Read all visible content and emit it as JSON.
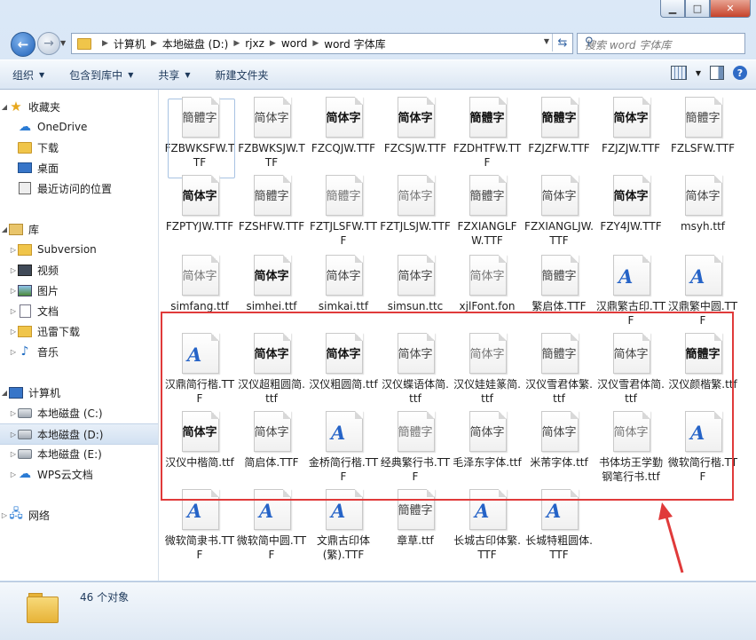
{
  "window": {
    "minimize": "▁",
    "maximize": "□",
    "close": "✕"
  },
  "breadcrumbs": [
    "计算机",
    "本地磁盘 (D:)",
    "rjxz",
    "word",
    "word 字体库"
  ],
  "search_placeholder": "搜索 word 字体库",
  "toolbar": {
    "organize": "组织",
    "include": "包含到库中",
    "share": "共享",
    "new_folder": "新建文件夹"
  },
  "sidebar": {
    "favorites": "收藏夹",
    "onedrive": "OneDrive",
    "downloads": "下载",
    "desktop": "桌面",
    "recent": "最近访问的位置",
    "libraries": "库",
    "subversion": "Subversion",
    "videos": "视频",
    "pictures": "图片",
    "documents": "文档",
    "xunlei": "迅雷下载",
    "music": "音乐",
    "computer": "计算机",
    "drive_c": "本地磁盘 (C:)",
    "drive_d": "本地磁盘 (D:)",
    "drive_e": "本地磁盘 (E:)",
    "wps": "WPS云文档",
    "network": "网络"
  },
  "files": [
    {
      "name": "FZBWKSFW.TTF",
      "glyph": "簡體字",
      "style": "mid"
    },
    {
      "name": "FZBWKSJW.TTF",
      "glyph": "简体字",
      "style": "mid"
    },
    {
      "name": "FZCQJW.TTF",
      "glyph": "简体字",
      "style": "bold"
    },
    {
      "name": "FZCSJW.TTF",
      "glyph": "简体字",
      "style": "bold"
    },
    {
      "name": "FZDHTFW.TTF",
      "glyph": "簡體字",
      "style": "bold"
    },
    {
      "name": "FZJZFW.TTF",
      "glyph": "簡體字",
      "style": "bold"
    },
    {
      "name": "FZJZJW.TTF",
      "glyph": "简体字",
      "style": "bold"
    },
    {
      "name": "FZLSFW.TTF",
      "glyph": "簡體字",
      "style": "mid"
    },
    {
      "name": "FZPTYJW.TTF",
      "glyph": "简体字",
      "style": "bold"
    },
    {
      "name": "FZSHFW.TTF",
      "glyph": "簡體字",
      "style": "mid"
    },
    {
      "name": "FZTJLSFW.TTF",
      "glyph": "簡體字",
      "style": "light"
    },
    {
      "name": "FZTJLSJW.TTF",
      "glyph": "简体字",
      "style": "light"
    },
    {
      "name": "FZXIANGLFW.TTF",
      "glyph": "簡體字",
      "style": "mid"
    },
    {
      "name": "FZXIANGLJW.TTF",
      "glyph": "简体字",
      "style": "mid"
    },
    {
      "name": "FZY4JW.TTF",
      "glyph": "简体字",
      "style": "bold"
    },
    {
      "name": "msyh.ttf",
      "glyph": "简体字",
      "style": "mid"
    },
    {
      "name": "simfang.ttf",
      "glyph": "简体字",
      "style": "light"
    },
    {
      "name": "simhei.ttf",
      "glyph": "简体字",
      "style": "bold"
    },
    {
      "name": "simkai.ttf",
      "glyph": "简体字",
      "style": "mid"
    },
    {
      "name": "simsun.ttc",
      "glyph": "简体字",
      "style": "mid"
    },
    {
      "name": "xjlFont.fon",
      "glyph": "简体字",
      "style": "light"
    },
    {
      "name": "繁启体.TTF",
      "glyph": "簡體字",
      "style": "mid"
    },
    {
      "name": "汉鼎繁古印.TTF",
      "glyph": "A",
      "style": "A"
    },
    {
      "name": "汉鼎繁中圆.TTF",
      "glyph": "A",
      "style": "A"
    },
    {
      "name": "汉鼎简行楷.TTF",
      "glyph": "A",
      "style": "A"
    },
    {
      "name": "汉仪超粗圆简.ttf",
      "glyph": "简体字",
      "style": "bold"
    },
    {
      "name": "汉仪粗圆简.ttf",
      "glyph": "简体字",
      "style": "bold"
    },
    {
      "name": "汉仪蝶语体简.ttf",
      "glyph": "简体字",
      "style": "mid"
    },
    {
      "name": "汉仪娃娃篆简.ttf",
      "glyph": "简体字",
      "style": "light"
    },
    {
      "name": "汉仪雪君体繁.ttf",
      "glyph": "簡體字",
      "style": "mid"
    },
    {
      "name": "汉仪雪君体简.ttf",
      "glyph": "简体字",
      "style": "mid"
    },
    {
      "name": "汉仪颜楷繁.ttf",
      "glyph": "簡體字",
      "style": "bold"
    },
    {
      "name": "汉仪中楷简.ttf",
      "glyph": "简体字",
      "style": "bold"
    },
    {
      "name": "简启体.TTF",
      "glyph": "简体字",
      "style": "mid"
    },
    {
      "name": "金桥简行楷.TTF",
      "glyph": "A",
      "style": "A"
    },
    {
      "name": "经典繁行书.TTF",
      "glyph": "簡體字",
      "style": "light"
    },
    {
      "name": "毛泽东字体.ttf",
      "glyph": "简体字",
      "style": "mid"
    },
    {
      "name": "米芾字体.ttf",
      "glyph": "简体字",
      "style": "mid"
    },
    {
      "name": "书体坊王学勤钢笔行书.ttf",
      "glyph": "简体字",
      "style": "light"
    },
    {
      "name": "微软简行楷.TTF",
      "glyph": "A",
      "style": "A"
    },
    {
      "name": "微软简隶书.TTF",
      "glyph": "A",
      "style": "A"
    },
    {
      "name": "微软简中圆.TTF",
      "glyph": "A",
      "style": "A"
    },
    {
      "name": "文鼎古印体(繁).TTF",
      "glyph": "A",
      "style": "A"
    },
    {
      "name": "章草.ttf",
      "glyph": "簡體字",
      "style": "mid"
    },
    {
      "name": "长城古印体繁.TTF",
      "glyph": "A",
      "style": "A"
    },
    {
      "name": "长城特粗圆体.TTF",
      "glyph": "A",
      "style": "A"
    }
  ],
  "status": {
    "count": "46 个对象"
  },
  "colors": {
    "annotation": "#e03a3a",
    "accent": "#2563c7"
  }
}
